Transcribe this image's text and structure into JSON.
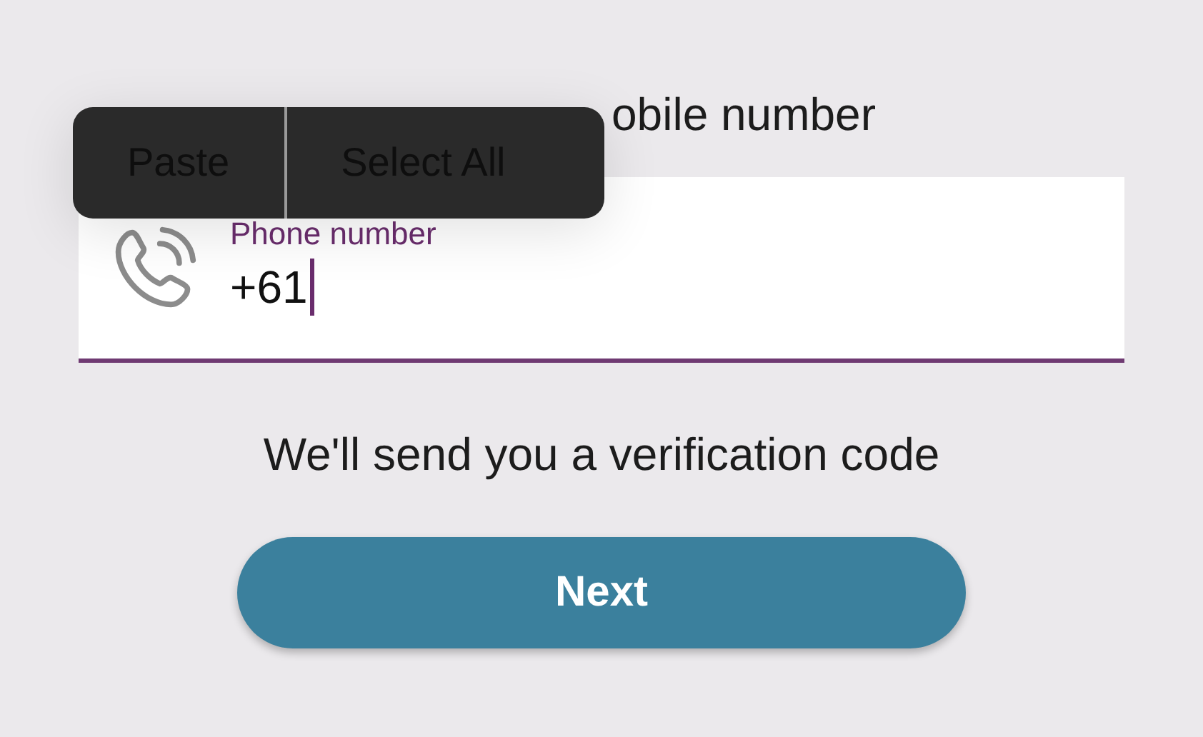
{
  "title": "obile number",
  "context_menu": [
    {
      "label": "Paste"
    },
    {
      "label": "Select All"
    }
  ],
  "phone_field": {
    "label": "Phone number",
    "value": "+61"
  },
  "hint": "We'll send you a verification code",
  "next_button": {
    "label": "Next"
  }
}
